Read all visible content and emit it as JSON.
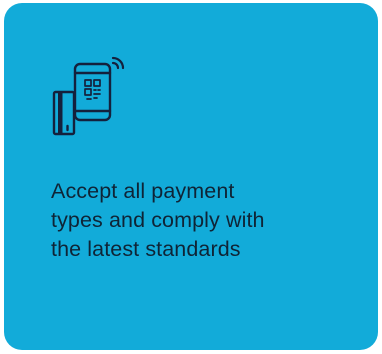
{
  "card": {
    "icon": "phone-card-qr-payment-icon",
    "headline": "Accept all payment\ntypes and comply with\nthe latest standards"
  },
  "colors": {
    "card_background": "#12abd9",
    "icon_stroke": "#14213d",
    "text": "#0f2436"
  }
}
